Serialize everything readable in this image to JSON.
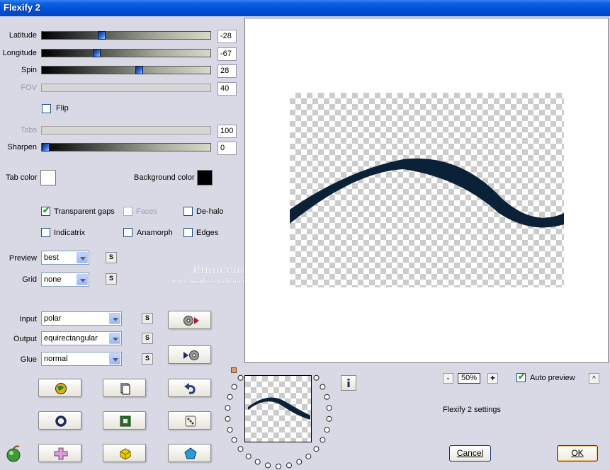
{
  "window": {
    "title": "Flexify 2"
  },
  "sliders": [
    {
      "label": "Latitude",
      "value": "-28",
      "position": 0.36,
      "enabled": true
    },
    {
      "label": "Longitude",
      "value": "-67",
      "position": 0.33,
      "enabled": true
    },
    {
      "label": "Spin",
      "value": "28",
      "position": 0.58,
      "enabled": true
    },
    {
      "label": "FOV",
      "value": "40",
      "position": null,
      "enabled": false
    }
  ],
  "flip": {
    "label": "Flip",
    "checked": false
  },
  "tabs": {
    "label": "Tabs",
    "value": "100",
    "enabled": false
  },
  "sharpen": {
    "label": "Sharpen",
    "value": "0",
    "position": 0.0
  },
  "colors": {
    "tab_color_label": "Tab color",
    "tab_color": "#ffffff",
    "background_color_label": "Background color",
    "background_color": "#000000"
  },
  "options": {
    "transparent_gaps": {
      "label": "Transparent gaps",
      "checked": true
    },
    "faces": {
      "label": "Faces",
      "checked": false,
      "enabled": false
    },
    "de_halo": {
      "label": "De-halo",
      "checked": false
    },
    "indicatrix": {
      "label": "Indicatrix",
      "checked": false
    },
    "anamorph": {
      "label": "Anamorph",
      "checked": false
    },
    "edges": {
      "label": "Edges",
      "checked": false
    }
  },
  "preview_opt": {
    "label": "Preview",
    "value": "best"
  },
  "grid_opt": {
    "label": "Grid",
    "value": "none"
  },
  "input_opt": {
    "label": "Input",
    "value": "polar"
  },
  "output_opt": {
    "label": "Output",
    "value": "equirectangular"
  },
  "glue_opt": {
    "label": "Glue",
    "value": "normal"
  },
  "s_label": "S",
  "watermark": {
    "line1": "Pinuccia",
    "line2": "www.maidiregrafica.eu"
  },
  "zoom": {
    "value": "50%",
    "minus": "-",
    "plus": "+"
  },
  "auto_preview": {
    "label": "Auto preview",
    "checked": true
  },
  "settings_label": "Flexify 2 settings",
  "collapse_glyph": "^",
  "buttons": {
    "cancel": "Cancel",
    "ok": "OK"
  },
  "accent": "#0a5fe0",
  "wave_color": "#0b2138"
}
